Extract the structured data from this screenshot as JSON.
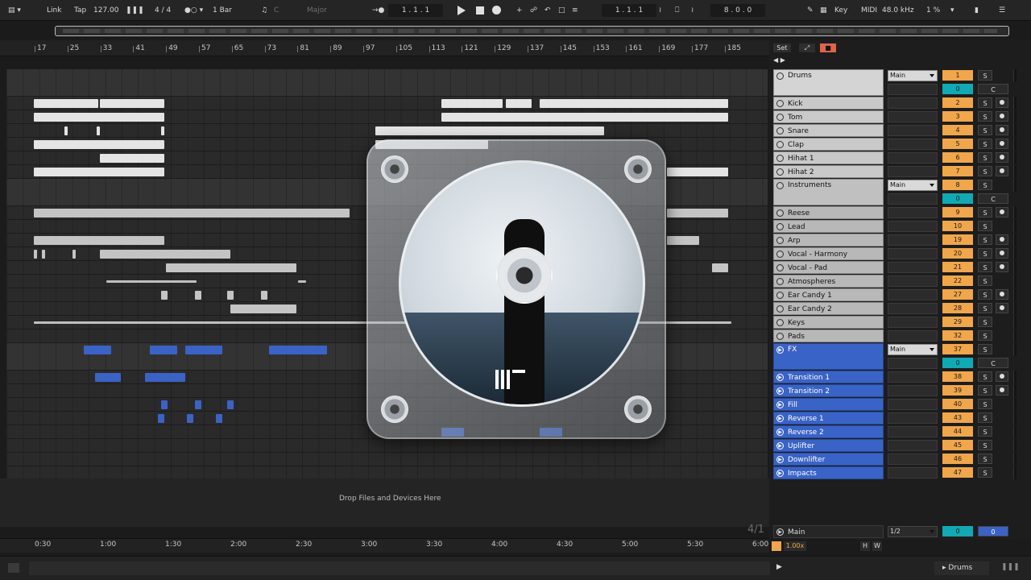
{
  "transport": {
    "link": "Link",
    "tap": "Tap",
    "tempo": "127.00",
    "signature": "4 / 4",
    "quantize": "1 Bar",
    "key": "C",
    "scale": "Major",
    "position": "1 .  1 .  1",
    "loop_start": "1 .  1 .  1",
    "loop_length": "8 .  0 .  0",
    "key_label": "Key",
    "midi_label": "MIDI",
    "sample_rate": "48.0 kHz",
    "cpu": "1 %"
  },
  "ruler": {
    "bars": [
      "17",
      "25",
      "33",
      "41",
      "49",
      "57",
      "65",
      "73",
      "81",
      "89",
      "97",
      "105",
      "113",
      "121",
      "129",
      "137",
      "145",
      "153",
      "161",
      "169",
      "177",
      "185"
    ]
  },
  "time_ruler": {
    "labels": [
      "0:30",
      "1:00",
      "1:30",
      "2:00",
      "2:30",
      "3:00",
      "3:30",
      "4:00",
      "4:30",
      "5:00",
      "5:30",
      "6:00"
    ]
  },
  "drop_text": "Drop Files and Devices Here",
  "time_signature_marker": "4/1",
  "mixer_header": {
    "set_label": "Set"
  },
  "tracks": [
    {
      "name": "Drums",
      "kind": "group",
      "color": "drums",
      "route": "Main",
      "num": "1",
      "solo": "S",
      "sub": "0",
      "c": "C"
    },
    {
      "name": "Kick",
      "kind": "track",
      "color": "drums",
      "num": "2",
      "solo": "S",
      "mon": true
    },
    {
      "name": "Tom",
      "kind": "track",
      "color": "drums",
      "num": "3",
      "solo": "S",
      "mon": true
    },
    {
      "name": "Snare",
      "kind": "track",
      "color": "drums",
      "num": "4",
      "solo": "S",
      "mon": true
    },
    {
      "name": "Clap",
      "kind": "track",
      "color": "drums",
      "num": "5",
      "solo": "S",
      "mon": true
    },
    {
      "name": "Hihat 1",
      "kind": "track",
      "color": "drums",
      "num": "6",
      "solo": "S",
      "mon": true
    },
    {
      "name": "Hihat 2",
      "kind": "track",
      "color": "drums",
      "num": "7",
      "solo": "S",
      "mon": true
    },
    {
      "name": "Instruments",
      "kind": "group",
      "color": "inst",
      "route": "Main",
      "num": "8",
      "solo": "S",
      "sub": "0",
      "c": "C"
    },
    {
      "name": "Reese",
      "kind": "track",
      "color": "inst",
      "num": "9",
      "solo": "S",
      "mon": true
    },
    {
      "name": "Lead",
      "kind": "track",
      "color": "inst",
      "num": "10",
      "solo": "S",
      "mon": false
    },
    {
      "name": "Arp",
      "kind": "track",
      "color": "inst",
      "num": "19",
      "solo": "S",
      "mon": true
    },
    {
      "name": "Vocal - Harmony",
      "kind": "track",
      "color": "inst",
      "num": "20",
      "solo": "S",
      "mon": true
    },
    {
      "name": "Vocal - Pad",
      "kind": "track",
      "color": "inst",
      "num": "21",
      "solo": "S",
      "mon": true
    },
    {
      "name": "Atmospheres",
      "kind": "track",
      "color": "inst",
      "num": "22",
      "solo": "S",
      "mon": false
    },
    {
      "name": "Ear Candy 1",
      "kind": "track",
      "color": "inst",
      "num": "27",
      "solo": "S",
      "mon": true
    },
    {
      "name": "Ear Candy 2",
      "kind": "track",
      "color": "inst",
      "num": "28",
      "solo": "S",
      "mon": true
    },
    {
      "name": "Keys",
      "kind": "track",
      "color": "inst",
      "num": "29",
      "solo": "S",
      "mon": false
    },
    {
      "name": "Pads",
      "kind": "track",
      "color": "inst",
      "num": "32",
      "solo": "S",
      "mon": false
    },
    {
      "name": "FX",
      "kind": "group",
      "color": "fx",
      "route": "Main",
      "num": "37",
      "solo": "S",
      "sub": "0",
      "c": "C"
    },
    {
      "name": "Transition 1",
      "kind": "track",
      "color": "fx",
      "num": "38",
      "solo": "S",
      "mon": true
    },
    {
      "name": "Transition 2",
      "kind": "track",
      "color": "fx",
      "num": "39",
      "solo": "S",
      "mon": true
    },
    {
      "name": "Fill",
      "kind": "track",
      "color": "fx",
      "num": "40",
      "solo": "S",
      "mon": false
    },
    {
      "name": "Reverse 1",
      "kind": "track",
      "color": "fx",
      "num": "43",
      "solo": "S",
      "mon": false
    },
    {
      "name": "Reverse 2",
      "kind": "track",
      "color": "fx",
      "num": "44",
      "solo": "S",
      "mon": false
    },
    {
      "name": "Uplifter",
      "kind": "track",
      "color": "fx",
      "num": "45",
      "solo": "S",
      "mon": false
    },
    {
      "name": "Downlifter",
      "kind": "track",
      "color": "fx",
      "num": "46",
      "solo": "S",
      "mon": false
    },
    {
      "name": "Impacts",
      "kind": "track",
      "color": "fx",
      "num": "47",
      "solo": "S",
      "mon": false
    }
  ],
  "main_track": {
    "name": "Main",
    "route": "1/2",
    "val_a": "0",
    "val_b": "0"
  },
  "zoom": {
    "value": "1.00x",
    "h_label": "H",
    "w_label": "W"
  },
  "status": {
    "selected_track": "Drums"
  },
  "colors": {
    "drums": "#e4e4e4",
    "inst": "#c4c4c4",
    "fx": "#3b63c6",
    "orange": "#f0a64a",
    "teal": "#11a9b3"
  }
}
